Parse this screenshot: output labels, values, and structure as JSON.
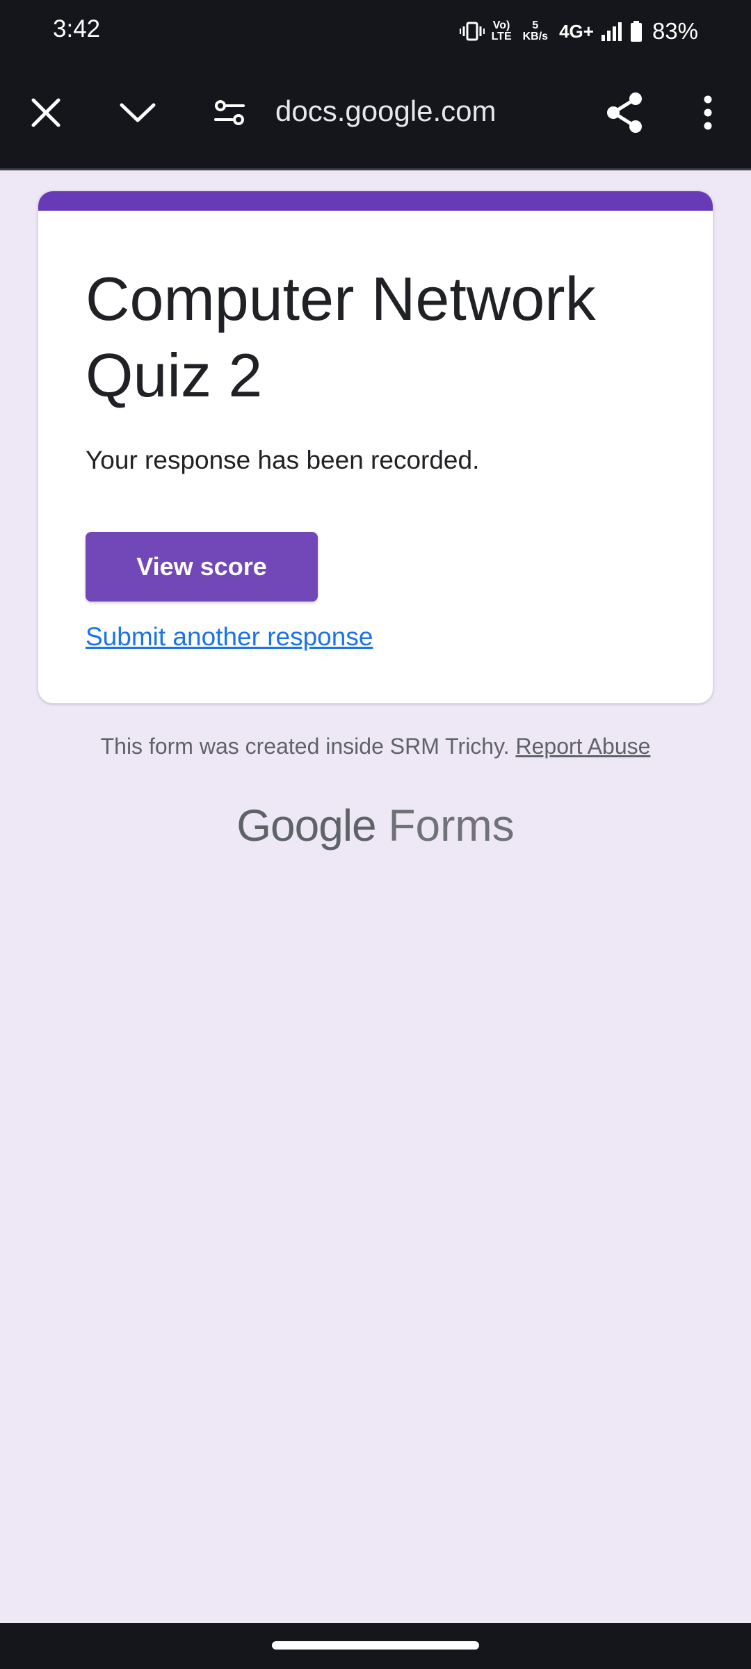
{
  "status_bar": {
    "time": "3:42",
    "icons": [
      "vibrate-icon",
      "volte-icon",
      "network-speed",
      "4g-plus-icon",
      "signal-icon",
      "battery-icon"
    ],
    "volte_line1": "Vo)",
    "volte_line2": "LTE",
    "speed_value": "5",
    "speed_unit": "KB/s",
    "network": "4G+",
    "battery_percent": "83%"
  },
  "toolbar": {
    "url": "docs.google.com",
    "buttons": [
      "close-icon",
      "chevron-down-icon",
      "site-settings-icon",
      "share-icon",
      "more-vert-icon"
    ]
  },
  "form": {
    "title": "Computer Network Quiz 2",
    "message": "Your response has been recorded.",
    "view_score_label": "View score",
    "submit_another_label": "Submit another response",
    "accent_color": "#673ab7",
    "button_color": "#7248b9"
  },
  "footer": {
    "note": "This form was created inside SRM Trichy.",
    "report_abuse": "Report Abuse",
    "brand_google": "Google",
    "brand_forms": "Forms"
  }
}
